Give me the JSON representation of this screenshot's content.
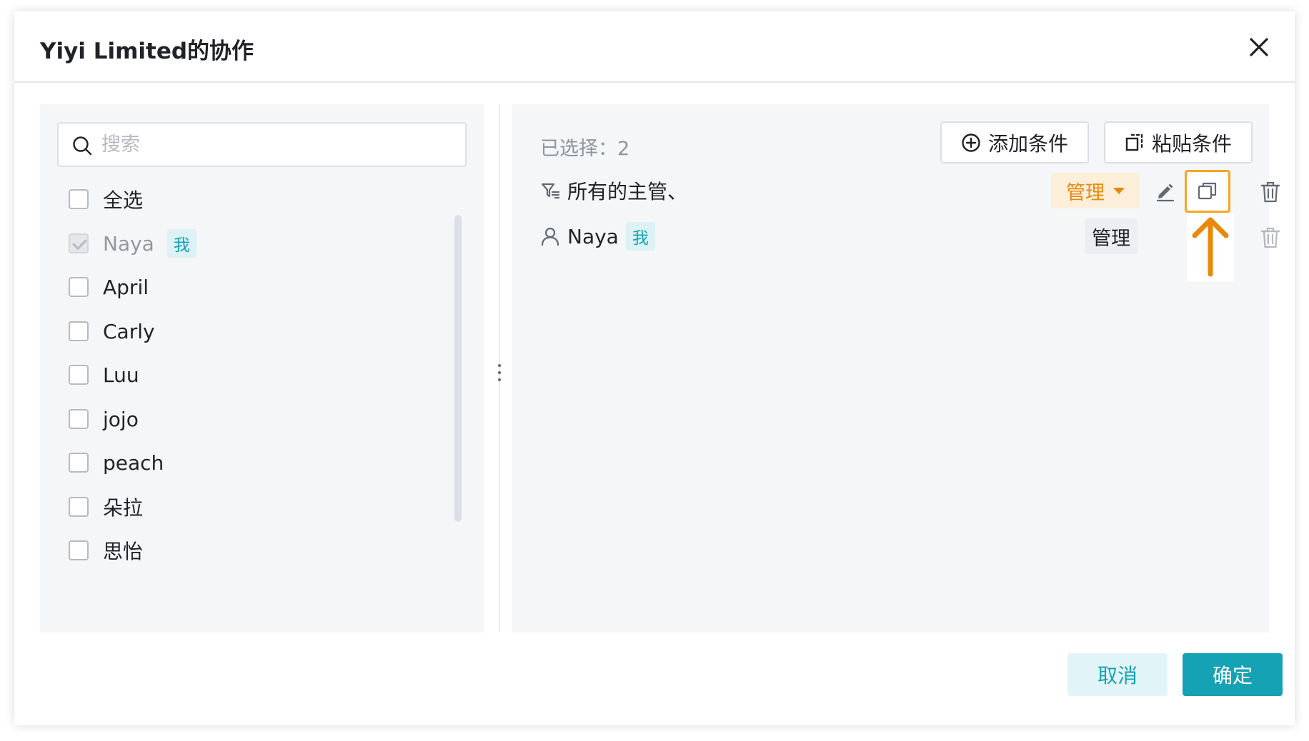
{
  "dialog": {
    "title": "Yiyi Limited的协作",
    "close_icon": "close-icon"
  },
  "left": {
    "search_placeholder": "搜索",
    "select_all_label": "全选",
    "members": [
      {
        "name": "Naya",
        "tag": "我",
        "checked": true,
        "disabled": true
      },
      {
        "name": "April"
      },
      {
        "name": "Carly"
      },
      {
        "name": "Luu"
      },
      {
        "name": "jojo"
      },
      {
        "name": "peach"
      },
      {
        "name": "朵拉"
      },
      {
        "name": "思怡"
      }
    ]
  },
  "right": {
    "selected_label": "已选择：2",
    "add_condition_label": "添加条件",
    "paste_condition_label": "粘贴条件",
    "items": [
      {
        "icon": "filter-icon",
        "label": "所有的主管、",
        "role": "管理",
        "role_editable": true
      },
      {
        "icon": "user-icon",
        "label": "Naya",
        "tag": "我",
        "role": "管理",
        "role_editable": false
      }
    ]
  },
  "footer": {
    "cancel_label": "取消",
    "ok_label": "确定"
  },
  "colors": {
    "accent": "#14a2b4",
    "highlight": "#f5a623",
    "role_dropdown_text": "#e8890c"
  }
}
